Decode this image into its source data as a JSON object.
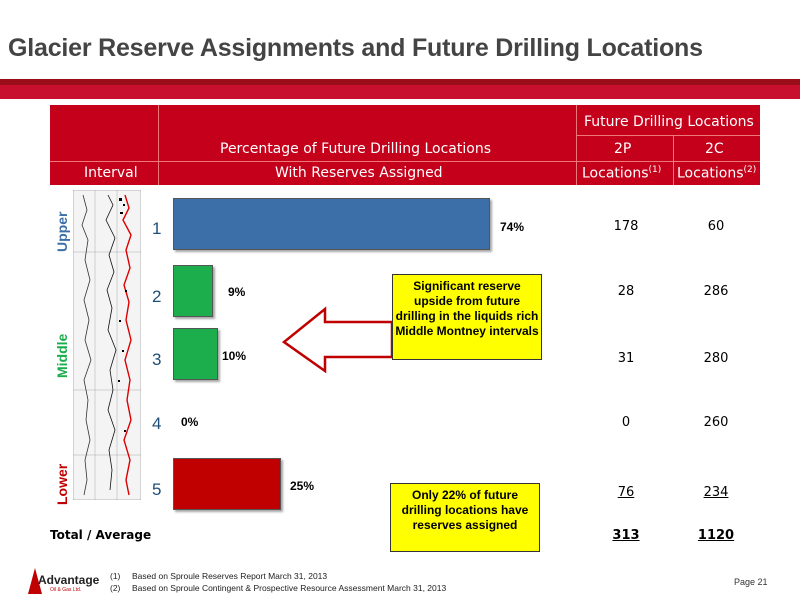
{
  "title": "Glacier Reserve Assignments and Future Drilling Locations",
  "table": {
    "header_group": "Future Drilling Locations",
    "col_pct_line1": "Percentage of Future Drilling Locations",
    "col_pct_line2": "With Reserves Assigned",
    "col_interval": "Interval",
    "col_2p": "2P",
    "col_2c": "2C",
    "col_2p_sub": "Locations",
    "col_2c_sub": "Locations",
    "footnote_mark_1": "(1)",
    "footnote_mark_2": "(2)"
  },
  "side_labels": {
    "upper": "Upper",
    "middle": "Middle",
    "lower": "Lower"
  },
  "colors": {
    "upper": "#3c6fa8",
    "middle": "#1cad4c",
    "lower": "#c00000",
    "header": "#c4001a"
  },
  "chart_data": {
    "type": "bar",
    "categories": [
      "1",
      "2",
      "3",
      "4",
      "5"
    ],
    "values": [
      74,
      9,
      10,
      0,
      25
    ],
    "value_labels": [
      "74%",
      "9%",
      "10%",
      "0%",
      "25%"
    ],
    "xlim": [
      0,
      100
    ]
  },
  "rows": [
    {
      "interval": "1",
      "p2": "178",
      "c2": "60"
    },
    {
      "interval": "2",
      "p2": "28",
      "c2": "286"
    },
    {
      "interval": "3",
      "p2": "31",
      "c2": "280"
    },
    {
      "interval": "4",
      "p2": "0",
      "c2": "260"
    },
    {
      "interval": "5",
      "p2": "76",
      "c2": "234"
    }
  ],
  "total": {
    "label": "Total / Average",
    "p2": "313",
    "c2": "1120"
  },
  "callout_1": "Significant reserve upside from future drilling in the liquids rich Middle Montney intervals",
  "callout_2": "Only 22% of future drilling locations have reserves assigned",
  "footnotes": [
    {
      "mark": "(1)",
      "text": "Based on Sproule Reserves Report March 31, 2013"
    },
    {
      "mark": "(2)",
      "text": "Based on Sproule Contingent & Prospective Resource Assessment March 31, 2013"
    }
  ],
  "logo": {
    "name": "Advantage",
    "sub": "Oil & Gas Ltd."
  },
  "page": "Page 21"
}
